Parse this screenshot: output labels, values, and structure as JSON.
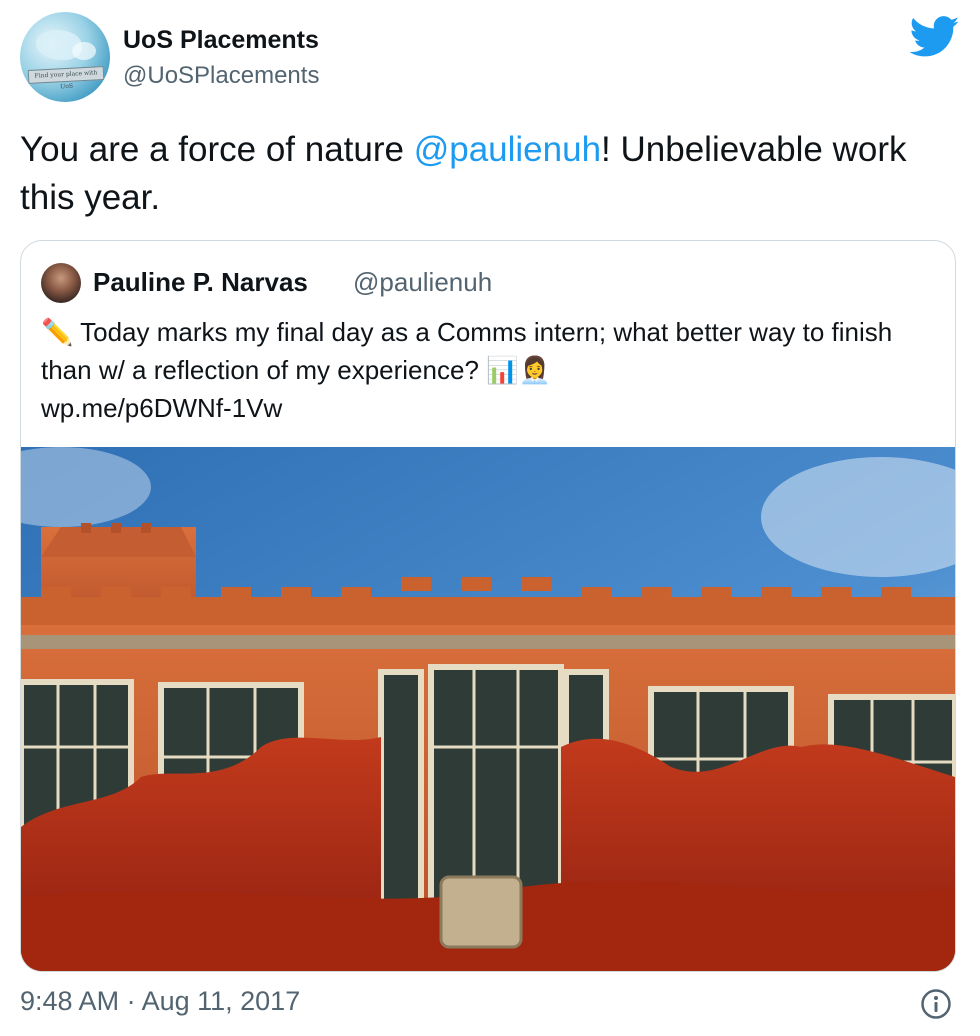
{
  "author": {
    "name": "UoS Placements",
    "handle": "@UoSPlacements",
    "avatar_text": "Find your place with UoS"
  },
  "tweet": {
    "text_before": "You are a force of nature ",
    "mention": "@paulienuh",
    "text_after": "! Unbelievable work this year."
  },
  "quoted": {
    "name": "Pauline P. Narvas",
    "handle": "@paulienuh",
    "emoji_pencil": "✏️",
    "text": "Today marks my final day as a Comms intern; what better way to finish than w/ a reflection of my experience?",
    "emoji_end": "📊👩‍💼",
    "link": "wp.me/p6DWNf-1Vw"
  },
  "footer": {
    "timestamp": "9:48 AM · Aug 11, 2017"
  },
  "icons": {
    "brand": "twitter-bird-icon",
    "info": "info-icon"
  },
  "colors": {
    "link": "#1d9bf0",
    "secondary_text": "#536471",
    "border": "#cfd9de"
  }
}
